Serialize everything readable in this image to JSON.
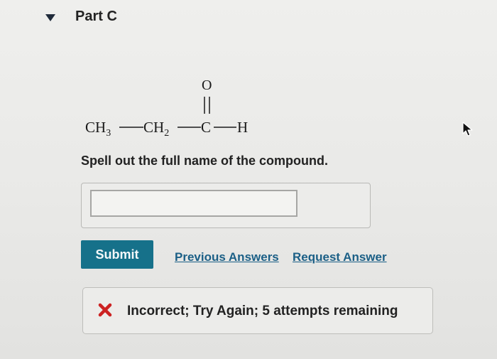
{
  "part": {
    "title": "Part C"
  },
  "formula": {
    "carbonyl_oxygen": "O",
    "group1_main": "CH",
    "group1_sub": "3",
    "group2_main": "CH",
    "group2_sub": "2",
    "carbonyl_carbon": "C",
    "hydrogen": "H"
  },
  "question": {
    "prompt": "Spell out the full name of the compound."
  },
  "answer": {
    "value": "",
    "placeholder": ""
  },
  "actions": {
    "submit_label": "Submit",
    "previous_answers_label": "Previous Answers",
    "request_answer_label": "Request Answer"
  },
  "feedback": {
    "status_icon": "x-icon",
    "status_color": "#cc2222",
    "text": "Incorrect; Try Again; 5 attempts remaining"
  },
  "colors": {
    "accent": "#16718a",
    "link": "#1b5f86"
  }
}
